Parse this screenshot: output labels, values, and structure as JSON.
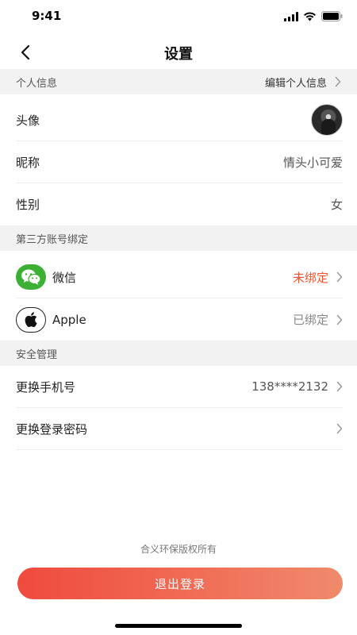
{
  "status_bar": {
    "time": "9:41"
  },
  "nav": {
    "title": "设置"
  },
  "personal_info": {
    "header": "个人信息",
    "edit_label": "编辑个人信息",
    "rows": {
      "avatar_label": "头像",
      "nickname_label": "昵称",
      "nickname_value": "情头小可爱",
      "gender_label": "性别",
      "gender_value": "女"
    }
  },
  "third_party": {
    "header": "第三方账号绑定",
    "wechat_label": "微信",
    "wechat_status": "未绑定",
    "apple_label": "Apple",
    "apple_status": "已绑定"
  },
  "security": {
    "header": "安全管理",
    "phone_label": "更换手机号",
    "phone_value": "138****2132",
    "password_label": "更换登录密码"
  },
  "footer": {
    "copyright": "合义环保版权所有",
    "logout_label": "退出登录"
  },
  "colors": {
    "accent": "#f0552e",
    "wechat_green": "#3cb034",
    "gradient_start": "#ef4a3d",
    "gradient_end": "#f08a6b"
  }
}
